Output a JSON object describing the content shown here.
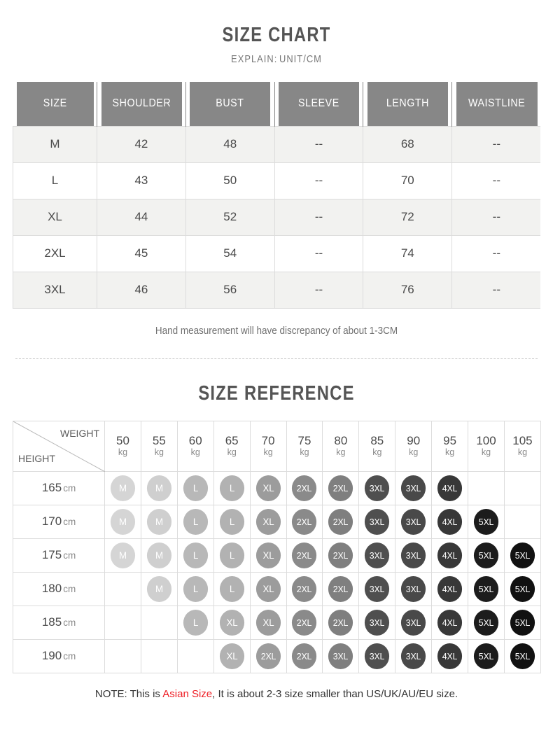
{
  "chart_data": {
    "type": "table",
    "title": "SIZE CHART",
    "subtitle_label": "EXPLAIN:",
    "subtitle_value": "UNIT/CM",
    "columns": [
      "SIZE",
      "SHOULDER",
      "BUST",
      "SLEEVE",
      "LENGTH",
      "WAISTLINE"
    ],
    "rows": [
      [
        "M",
        "42",
        "48",
        "--",
        "68",
        "--"
      ],
      [
        "L",
        "43",
        "50",
        "--",
        "70",
        "--"
      ],
      [
        "XL",
        "44",
        "52",
        "--",
        "72",
        "--"
      ],
      [
        "2XL",
        "45",
        "54",
        "--",
        "74",
        "--"
      ],
      [
        "3XL",
        "46",
        "56",
        "--",
        "76",
        "--"
      ]
    ],
    "footnote": "Hand measurement will have discrepancy of about 1-3CM",
    "reference": {
      "title": "SIZE REFERENCE",
      "weight_axis_label": "WEIGHT",
      "height_axis_label": "HEIGHT",
      "weight_unit": "kg",
      "height_unit": "cm",
      "weights": [
        "50",
        "55",
        "60",
        "65",
        "70",
        "75",
        "80",
        "85",
        "90",
        "95",
        "100",
        "105"
      ],
      "heights": [
        "165",
        "170",
        "175",
        "180",
        "185",
        "190"
      ],
      "grid": [
        [
          "M",
          "M",
          "L",
          "L",
          "XL",
          "2XL",
          "2XL",
          "3XL",
          "3XL",
          "4XL",
          "",
          ""
        ],
        [
          "M",
          "M",
          "L",
          "L",
          "XL",
          "2XL",
          "2XL",
          "3XL",
          "3XL",
          "4XL",
          "5XL",
          ""
        ],
        [
          "M",
          "M",
          "L",
          "L",
          "XL",
          "2XL",
          "2XL",
          "3XL",
          "3XL",
          "4XL",
          "5XL",
          "5XL"
        ],
        [
          "",
          "M",
          "L",
          "L",
          "XL",
          "2XL",
          "2XL",
          "3XL",
          "3XL",
          "4XL",
          "5XL",
          "5XL"
        ],
        [
          "",
          "",
          "L",
          "XL",
          "XL",
          "2XL",
          "2XL",
          "3XL",
          "3XL",
          "4XL",
          "5XL",
          "5XL"
        ],
        [
          "",
          "",
          "",
          "XL",
          "2XL",
          "2XL",
          "3XL",
          "3XL",
          "3XL",
          "4XL",
          "5XL",
          "5XL"
        ]
      ],
      "bubble_colors": [
        "#d5d5d5",
        "#cfcfcf",
        "#b8b8b8",
        "#b2b2b2",
        "#9c9c9c",
        "#8a8a8a",
        "#7f7f7f",
        "#4f4f4f",
        "#494949",
        "#383838",
        "#1c1c1c",
        "#111111"
      ]
    },
    "final_note_prefix": "NOTE: This is ",
    "final_note_highlight": "Asian Size",
    "final_note_suffix": ", It is about 2-3 size smaller than US/UK/AU/EU size.",
    "highlight_color": "#ee1c23",
    "header_color": "#878787"
  }
}
